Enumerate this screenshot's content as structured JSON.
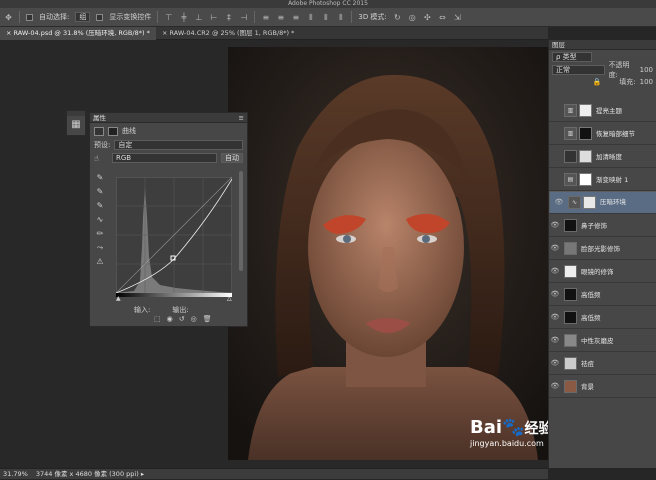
{
  "app": {
    "title": "Adobe Photoshop CC 2015"
  },
  "options_bar": {
    "auto_select_label": "自动选择:",
    "auto_select_value": "组",
    "show_transform_label": "显示变换控件",
    "mode_3d_label": "3D 模式:"
  },
  "tabs": [
    {
      "label": "RAW-04.psd @ 31.8% (压暗环境, RGB/8*) *",
      "close": "×"
    },
    {
      "label": "RAW-04.CR2 @ 25% (图层 1, RGB/8*) *",
      "close": "×"
    }
  ],
  "properties": {
    "panel_title": "属性",
    "section": "曲线",
    "preset_label": "预设:",
    "preset_value": "自定",
    "channel_value": "RGB",
    "auto_button": "自动",
    "input_label": "输入:",
    "output_label": "输出:"
  },
  "layers_panel": {
    "title": "图层",
    "filter_value": "类型",
    "blend_mode": "正常",
    "opacity_label": "不透明度:",
    "opacity_value": "100",
    "fill_label": "填充:",
    "fill_value": "100",
    "layers": [
      {
        "name": "提亮主题",
        "visible": false
      },
      {
        "name": "恢复暗部细节",
        "visible": false
      },
      {
        "name": "加清晰度",
        "visible": false
      },
      {
        "name": "渐变映射 1",
        "visible": false
      },
      {
        "name": "压暗环境",
        "visible": true,
        "selected": true
      },
      {
        "name": "鼻子修饰",
        "visible": true
      },
      {
        "name": "脸部光影修饰",
        "visible": true
      },
      {
        "name": "眼镜的修饰",
        "visible": true
      },
      {
        "name": "高低频",
        "visible": true
      },
      {
        "name": "高低频",
        "visible": true
      },
      {
        "name": "中性灰磨皮",
        "visible": true
      },
      {
        "name": "祛痘",
        "visible": true
      },
      {
        "name": "背景",
        "visible": true
      }
    ]
  },
  "status": {
    "zoom": "31.79%",
    "doc_info": "3744 像素 x 4680 像素 (300 ppi)"
  },
  "watermark": {
    "brand": "Bai",
    "brand2": "经验",
    "url": "jingyan.baidu.com"
  },
  "colors": {
    "eyeshadow": "#c0452a",
    "selected_layer": "#5a6c84",
    "panel_bg": "#474747"
  }
}
